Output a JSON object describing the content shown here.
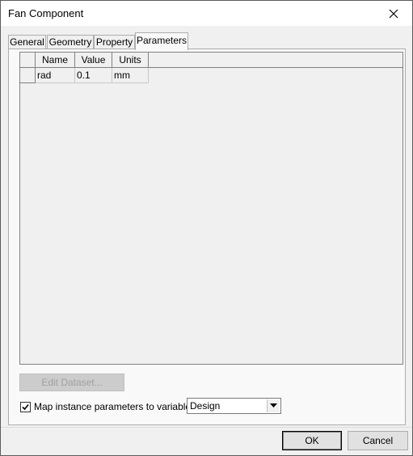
{
  "window": {
    "title": "Fan Component",
    "close_icon": "close-icon"
  },
  "tabs": [
    {
      "label": "General",
      "active": false
    },
    {
      "label": "Geometry",
      "active": false
    },
    {
      "label": "Property",
      "active": false
    },
    {
      "label": "Parameters",
      "active": true
    }
  ],
  "grid": {
    "columns": [
      "Name",
      "Value",
      "Units"
    ],
    "rows": [
      {
        "name": "rad",
        "value": "0.1",
        "units": "mm"
      }
    ]
  },
  "edit_dataset_label": "Edit Dataset...",
  "map_checkbox": {
    "checked": true,
    "label": "Map instance parameters to variables:"
  },
  "variables_combo": {
    "selected": "Design"
  },
  "buttons": {
    "ok": "OK",
    "cancel": "Cancel"
  }
}
